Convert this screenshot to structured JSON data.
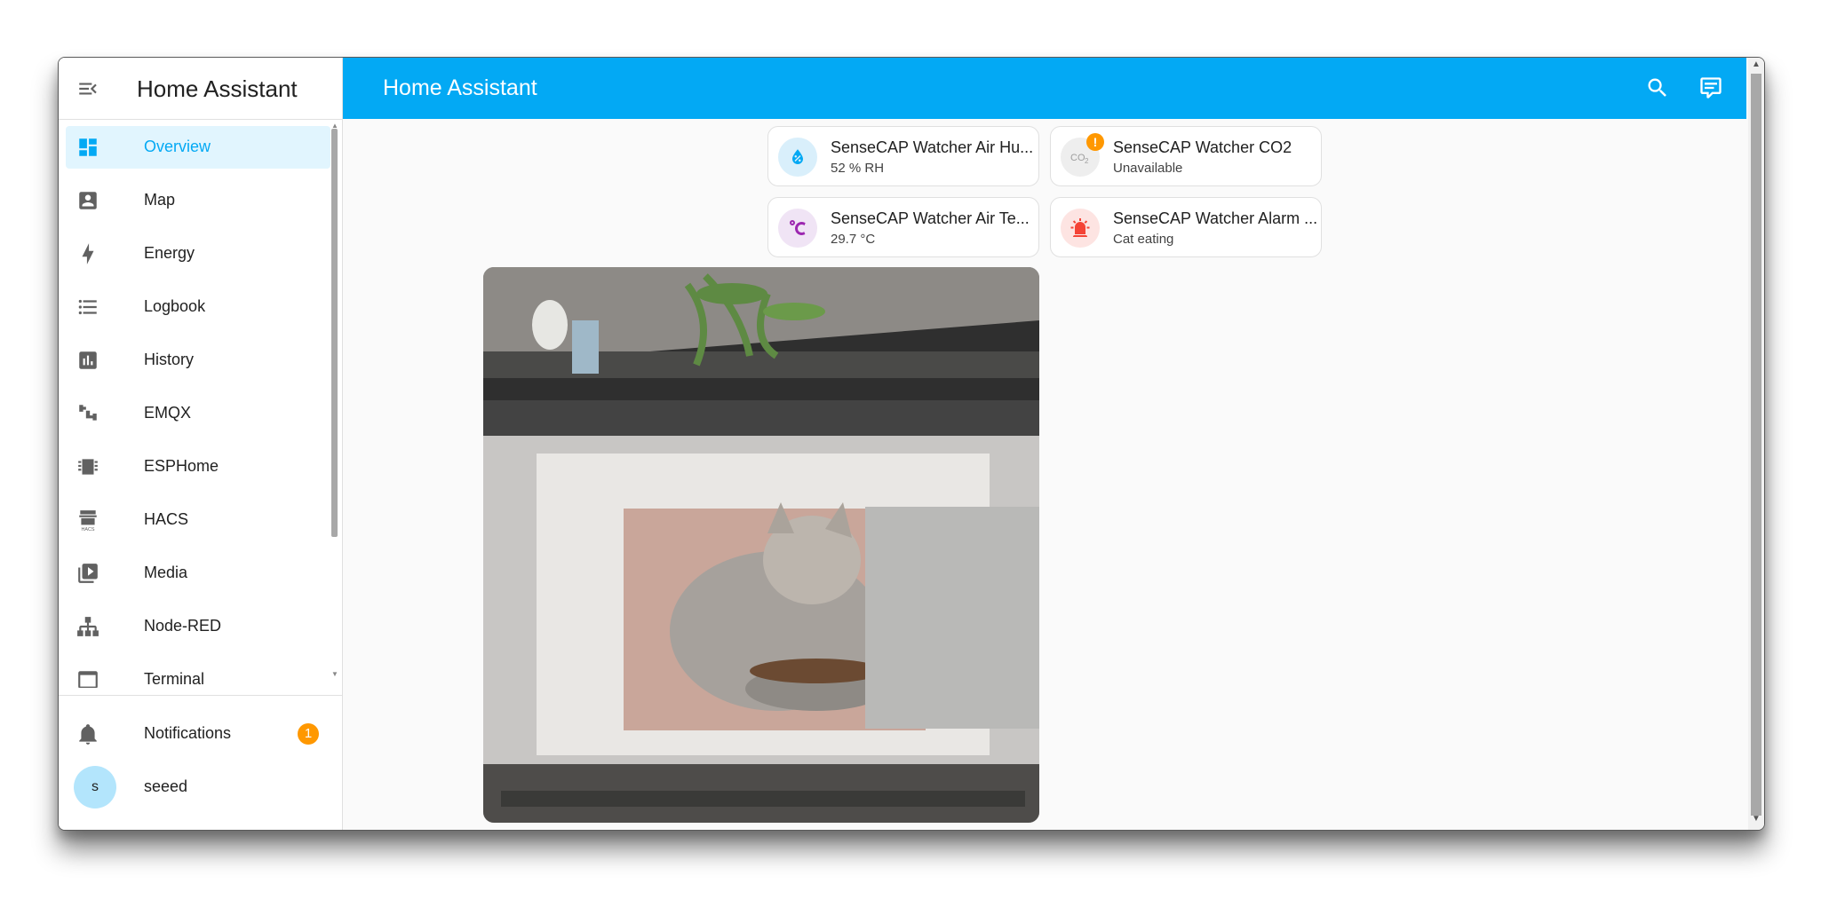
{
  "sidebar": {
    "title": "Home Assistant",
    "items": [
      {
        "label": "Overview",
        "icon": "view-dashboard-icon",
        "active": true
      },
      {
        "label": "Map",
        "icon": "account-box-icon"
      },
      {
        "label": "Energy",
        "icon": "lightning-bolt-icon"
      },
      {
        "label": "Logbook",
        "icon": "format-list-bulleted-icon"
      },
      {
        "label": "History",
        "icon": "chart-box-icon"
      },
      {
        "label": "EMQX",
        "icon": "pipe-icon"
      },
      {
        "label": "ESPHome",
        "icon": "chip-icon"
      },
      {
        "label": "HACS",
        "icon": "hacs-store-icon"
      },
      {
        "label": "Media",
        "icon": "play-box-multiple-icon"
      },
      {
        "label": "Node-RED",
        "icon": "sitemap-icon"
      },
      {
        "label": "Terminal",
        "icon": "console-icon"
      }
    ],
    "notifications": {
      "label": "Notifications",
      "count": "1"
    },
    "user": {
      "initial": "s",
      "name": "seeed"
    }
  },
  "header": {
    "title": "Home Assistant",
    "actions": [
      "search-icon",
      "assist-icon",
      "pencil-icon"
    ]
  },
  "tiles": [
    {
      "name": "SenseCAP Watcher Air Hu...",
      "state": "52 % RH",
      "icon": "water-percent-icon",
      "color": "#03a9f4"
    },
    {
      "name": "SenseCAP Watcher CO2",
      "state": "Unavailable",
      "icon": "molecule-co2-icon",
      "color": "#9e9e9e",
      "warning": "!"
    },
    {
      "name": "SenseCAP Watcher Air Te...",
      "state": "29.7 °C",
      "icon": "temperature-celsius-icon",
      "color": "#9c27b0"
    },
    {
      "name": "SenseCAP Watcher Alarm ...",
      "state": "Cat eating",
      "icon": "alarm-light-icon",
      "color": "#f44336"
    }
  ],
  "colors": {
    "accent": "#03a9f4",
    "badge": "#ff9800"
  }
}
